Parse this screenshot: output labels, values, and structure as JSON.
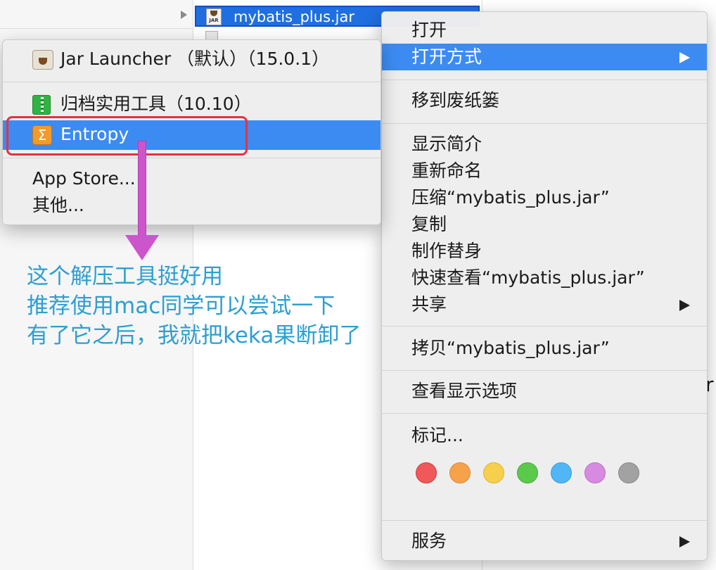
{
  "finder": {
    "selected_file": "mybatis_plus.jar",
    "file_icon_text": "JAR",
    "edge_text": "r"
  },
  "context_menu": {
    "items": [
      {
        "label": "打开"
      },
      {
        "label": "打开方式",
        "submenu": true,
        "highlighted": true
      },
      {
        "label": "移到废纸篓"
      },
      {
        "label": "显示简介"
      },
      {
        "label": "重新命名"
      },
      {
        "label": "压缩“mybatis_plus.jar”"
      },
      {
        "label": "复制"
      },
      {
        "label": "制作替身"
      },
      {
        "label": "快速查看“mybatis_plus.jar”"
      },
      {
        "label": "共享",
        "submenu": true
      },
      {
        "label": "拷贝“mybatis_plus.jar”"
      },
      {
        "label": "查看显示选项"
      },
      {
        "label": "标记..."
      },
      {
        "label": "服务",
        "submenu": true
      }
    ],
    "tag_colors": [
      {
        "name": "red",
        "fill": "#f0585a",
        "stroke": "#d23c3e"
      },
      {
        "name": "orange",
        "fill": "#f5a24b",
        "stroke": "#dd8a32"
      },
      {
        "name": "yellow",
        "fill": "#f6d04c",
        "stroke": "#dcb630"
      },
      {
        "name": "green",
        "fill": "#5bc94c",
        "stroke": "#42ad35"
      },
      {
        "name": "blue",
        "fill": "#50b6f5",
        "stroke": "#379ddc"
      },
      {
        "name": "purple",
        "fill": "#d68ae0",
        "stroke": "#bd70c8"
      },
      {
        "name": "gray",
        "fill": "#a2a2a2",
        "stroke": "#888888"
      }
    ]
  },
  "open_with_menu": {
    "items": [
      {
        "label": "Jar Launcher （默认）（15.0.1）",
        "icon": "jar-launcher-icon"
      },
      {
        "label": "归档实用工具（10.10）",
        "icon": "archive-utility-icon"
      },
      {
        "label": "Entropy",
        "icon": "entropy-icon",
        "icon_glyph": "Σ",
        "highlighted": true
      },
      {
        "label": "App Store..."
      },
      {
        "label": "其他..."
      }
    ]
  },
  "annotation": {
    "lines": [
      "这个解压工具挺好用",
      "推荐使用mac同学可以尝试一下",
      "有了它之后，我就把keka果断卸了"
    ],
    "text_color": "#2d9fd0",
    "arrow_color": "#cc55cc",
    "box_color": "#e8313f"
  }
}
